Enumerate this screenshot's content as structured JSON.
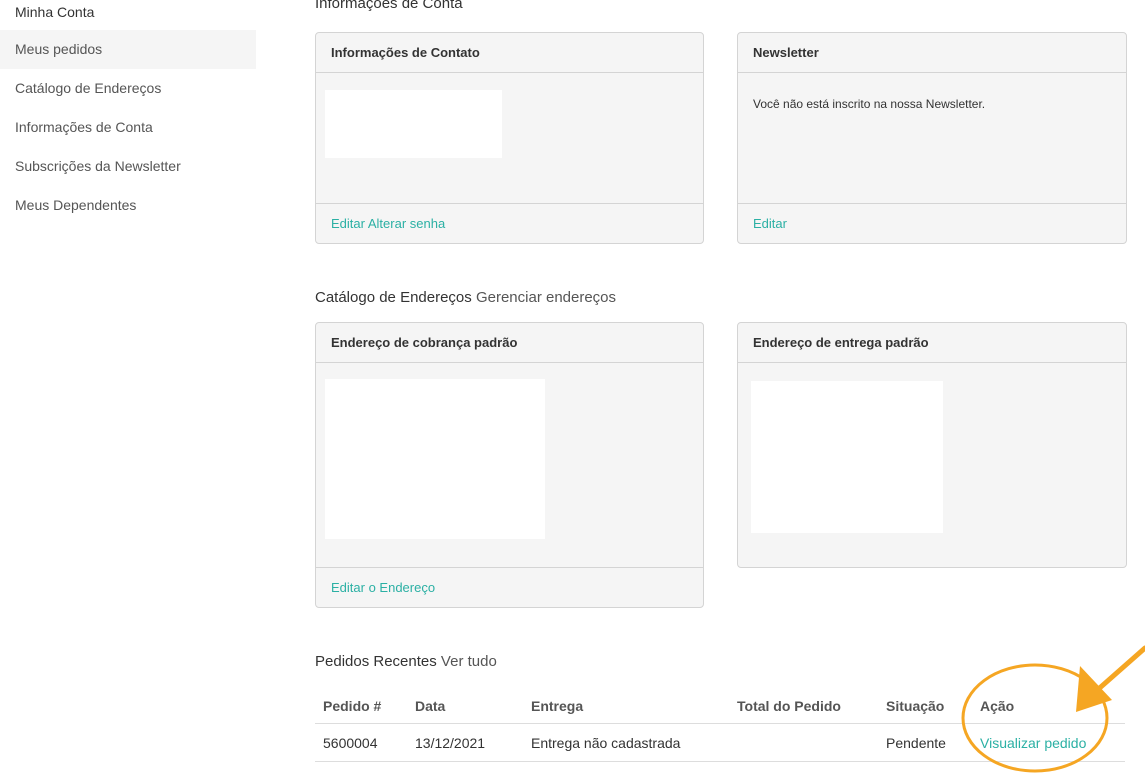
{
  "sidebar": {
    "items": [
      {
        "label": "Minha Conta"
      },
      {
        "label": "Meus pedidos"
      },
      {
        "label": "Catálogo de Endereços"
      },
      {
        "label": "Informações de Conta"
      },
      {
        "label": "Subscrições da Newsletter"
      },
      {
        "label": "Meus Dependentes"
      }
    ]
  },
  "account_info": {
    "title": "Informações de Conta",
    "contact_card": {
      "title": "Informações de Contato",
      "edit_label": "Editar",
      "change_password_label": "Alterar senha"
    },
    "newsletter_card": {
      "title": "Newsletter",
      "text": "Você não está inscrito na nossa Newsletter.",
      "edit_label": "Editar"
    }
  },
  "address_book": {
    "title": "Catálogo de Endereços",
    "manage_label": "Gerenciar endereços",
    "billing_card": {
      "title": "Endereço de cobrança padrão",
      "edit_label": "Editar o Endereço"
    },
    "shipping_card": {
      "title": "Endereço de entrega padrão"
    }
  },
  "recent_orders": {
    "title": "Pedidos Recentes",
    "view_all_label": "Ver tudo",
    "columns": [
      "Pedido #",
      "Data",
      "Entrega",
      "Total do Pedido",
      "Situação",
      "Ação"
    ],
    "rows": [
      {
        "order": "5600004",
        "date": "13/12/2021",
        "shipping": "Entrega não cadastrada",
        "total": "",
        "status": "Pendente",
        "action": "Visualizar pedido"
      }
    ]
  },
  "colors": {
    "link": "#2bb0a4",
    "annotation": "#f5a623",
    "card_bg": "#f5f5f5",
    "border": "#d4d4d4"
  },
  "icons": {
    "annotation": "arrow-icon"
  }
}
